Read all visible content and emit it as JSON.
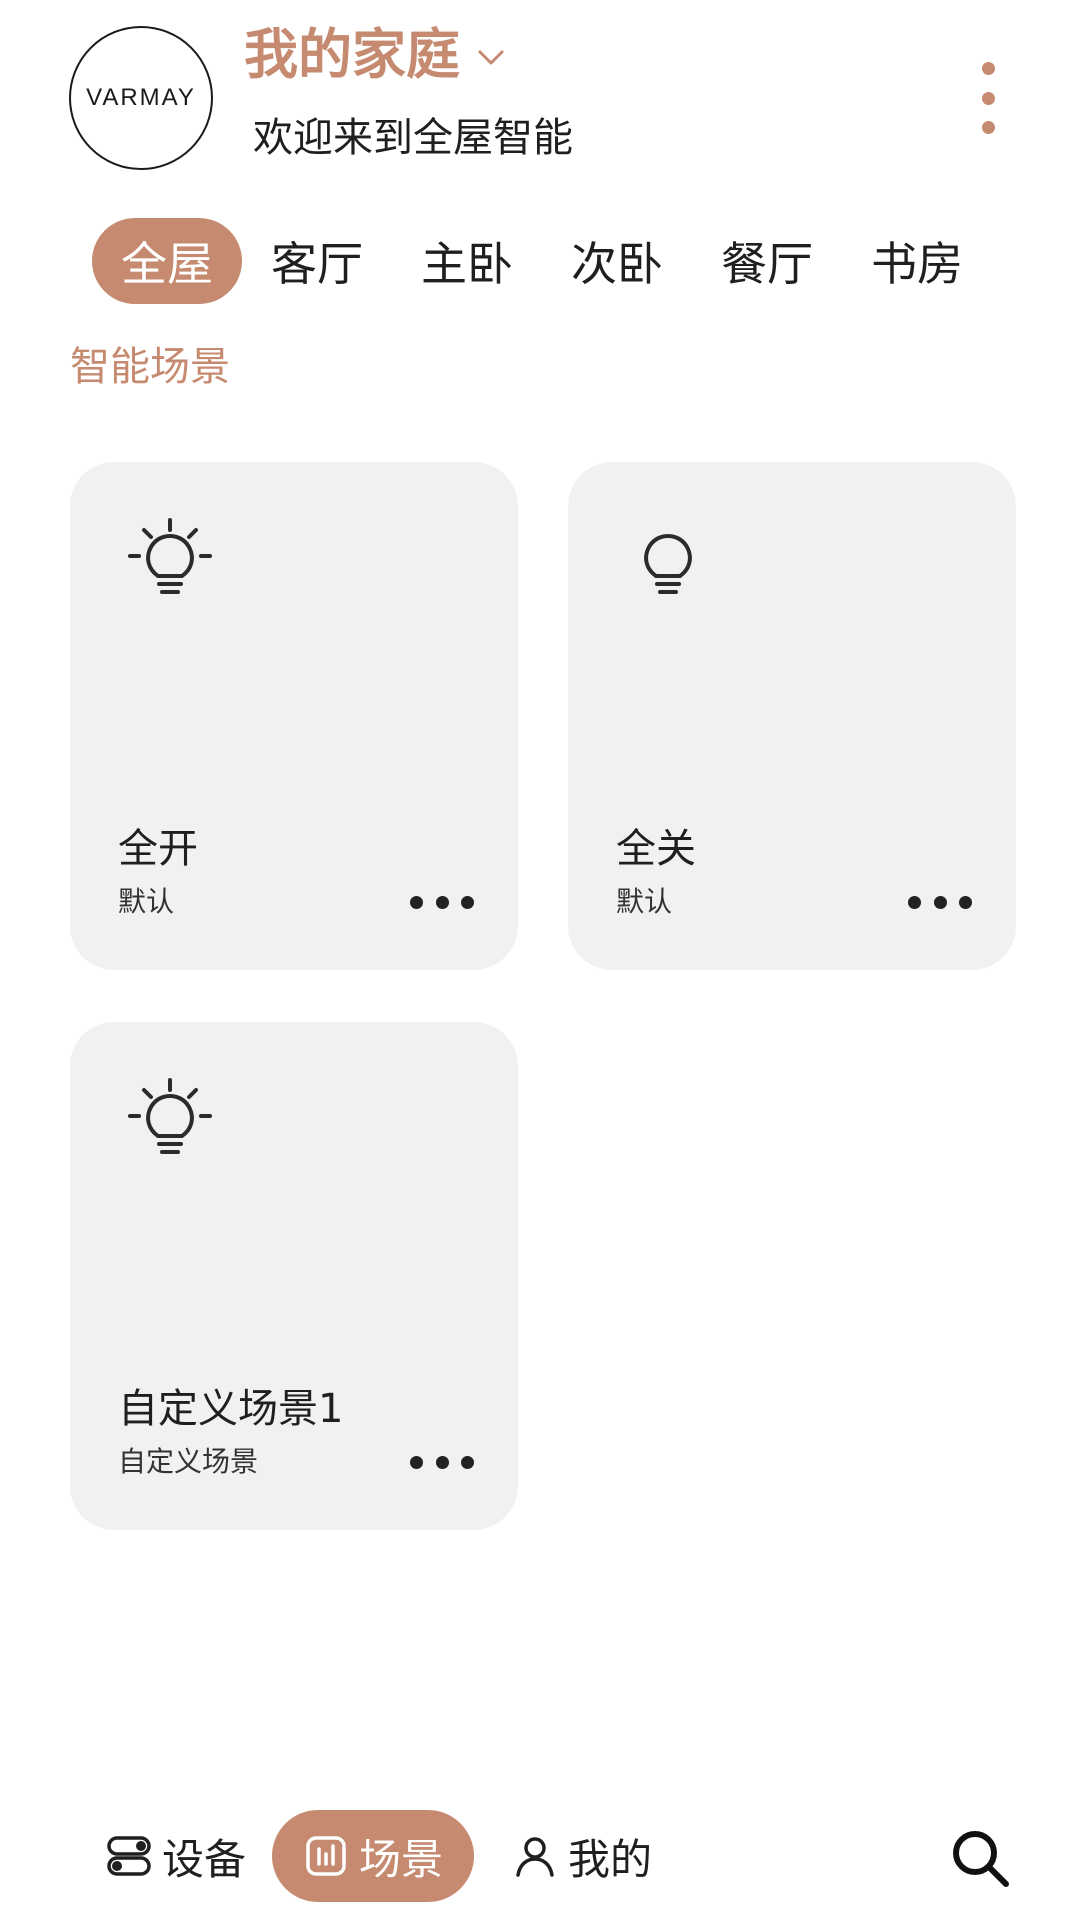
{
  "header": {
    "logo_text": "VARMAY",
    "home_title": "我的家庭",
    "welcome": "欢迎来到全屋智能"
  },
  "rooms": [
    {
      "label": "全屋",
      "active": true
    },
    {
      "label": "客厅",
      "active": false
    },
    {
      "label": "主卧",
      "active": false
    },
    {
      "label": "次卧",
      "active": false
    },
    {
      "label": "餐厅",
      "active": false
    },
    {
      "label": "书房",
      "active": false
    }
  ],
  "section_title": "智能场景",
  "scenes": [
    {
      "name": "全开",
      "subtitle": "默认",
      "icon": "bulb-on-icon"
    },
    {
      "name": "全关",
      "subtitle": "默认",
      "icon": "bulb-off-icon"
    },
    {
      "name": "自定义场景1",
      "subtitle": "自定义场景",
      "icon": "bulb-on-icon"
    }
  ],
  "nav": {
    "devices": "设备",
    "scenes": "场景",
    "mine": "我的"
  },
  "colors": {
    "accent": "#c58a6f",
    "card_bg": "#f1f1f0",
    "text": "#1f1f1f"
  }
}
